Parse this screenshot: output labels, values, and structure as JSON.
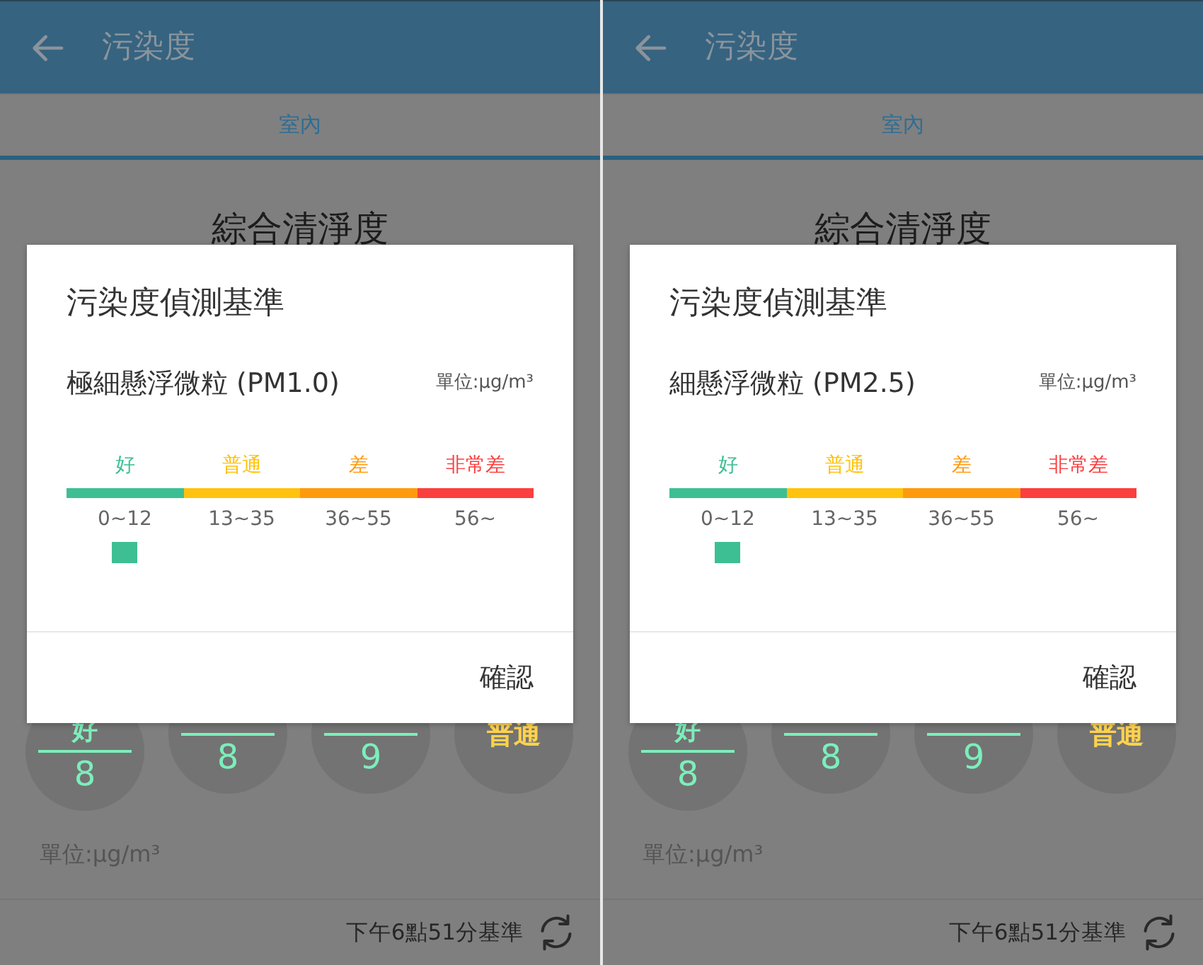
{
  "screens": [
    {
      "app_bar": {
        "title": "污染度"
      },
      "tabs": [
        {
          "label": "室內",
          "selected": true
        }
      ],
      "section_title": "綜合清淨度",
      "gauges": [
        {
          "kind": "labeled",
          "label": "好",
          "value": "8",
          "color": "#7ceebb"
        },
        {
          "kind": "value",
          "value": "8",
          "color": "#7ceebb"
        },
        {
          "kind": "value",
          "value": "9",
          "color": "#7ceebb"
        },
        {
          "kind": "text",
          "label": "普通",
          "color": "#ffd24d"
        }
      ],
      "unit_note": "單位:μg/m³",
      "footer": {
        "timestamp": "下午6點51分基準"
      },
      "dialog": {
        "title": "污染度偵測基準",
        "pollutant": "極細懸浮微粒 (PM1.0)",
        "unit": "單位:μg/m³",
        "levels": [
          {
            "label": "好",
            "range": "0~12",
            "color": "#3dbf93",
            "selected": true
          },
          {
            "label": "普通",
            "range": "13~35",
            "color": "#ffc20e",
            "selected": false
          },
          {
            "label": "差",
            "range": "36~55",
            "color": "#ff9a0e",
            "selected": false
          },
          {
            "label": "非常差",
            "range": "56~",
            "color": "#fb3f3f",
            "selected": false
          }
        ],
        "confirm_button": "確認"
      }
    },
    {
      "app_bar": {
        "title": "污染度"
      },
      "tabs": [
        {
          "label": "室內",
          "selected": true
        }
      ],
      "section_title": "綜合清淨度",
      "gauges": [
        {
          "kind": "labeled",
          "label": "好",
          "value": "8",
          "color": "#7ceebb"
        },
        {
          "kind": "value",
          "value": "8",
          "color": "#7ceebb"
        },
        {
          "kind": "value",
          "value": "9",
          "color": "#7ceebb"
        },
        {
          "kind": "text",
          "label": "普通",
          "color": "#ffd24d"
        }
      ],
      "unit_note": "單位:μg/m³",
      "footer": {
        "timestamp": "下午6點51分基準"
      },
      "dialog": {
        "title": "污染度偵測基準",
        "pollutant": "細懸浮微粒 (PM2.5)",
        "unit": "單位:μg/m³",
        "levels": [
          {
            "label": "好",
            "range": "0~12",
            "color": "#3dbf93",
            "selected": true
          },
          {
            "label": "普通",
            "range": "13~35",
            "color": "#ffc20e",
            "selected": false
          },
          {
            "label": "差",
            "range": "36~55",
            "color": "#ff9a0e",
            "selected": false
          },
          {
            "label": "非常差",
            "range": "56~",
            "color": "#fb3f3f",
            "selected": false
          }
        ],
        "confirm_button": "確認"
      }
    }
  ]
}
